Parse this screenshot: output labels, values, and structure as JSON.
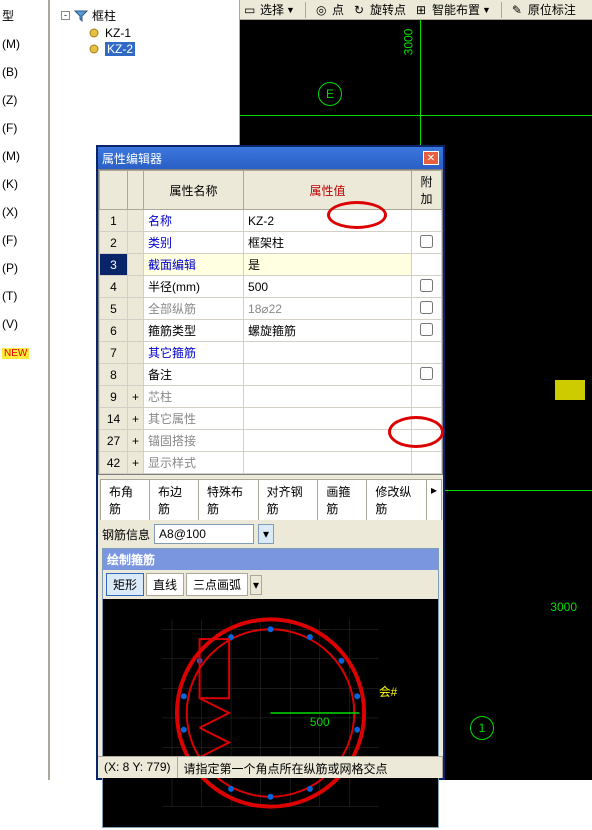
{
  "toolbar": {
    "select": "选择",
    "point": "点",
    "rotate_point": "旋转点",
    "smart_place": "智能布置",
    "origin_annot": "原位标注"
  },
  "left_items": [
    "型",
    "(M)",
    "(B)",
    "(Z)",
    "(F)",
    "(M)",
    "(K)",
    "(X)",
    "(F)",
    "(P)",
    "(T)",
    "(V)"
  ],
  "left_new": "NEW",
  "tree": {
    "root": "框柱",
    "children": [
      "KZ-1",
      "KZ-2"
    ]
  },
  "dialog_title": "属性编辑器",
  "grid": {
    "headers": {
      "name": "属性名称",
      "value": "属性值",
      "extra": "附加"
    },
    "rows": [
      {
        "n": "1",
        "name": "名称",
        "val": "KZ-2",
        "blue": true,
        "chk": false
      },
      {
        "n": "2",
        "name": "类别",
        "val": "框架柱",
        "blue": true,
        "chk": true
      },
      {
        "n": "3",
        "name": "截面编辑",
        "val": "是",
        "blue": true,
        "sel": true,
        "chk": false
      },
      {
        "n": "4",
        "name": "半径(mm)",
        "val": "500",
        "blue": false,
        "chk": true
      },
      {
        "n": "5",
        "name": "全部纵筋",
        "val": "18⌀22",
        "gray": true,
        "chk": true
      },
      {
        "n": "6",
        "name": "箍筋类型",
        "val": "螺旋箍筋",
        "blue": false,
        "chk": true
      },
      {
        "n": "7",
        "name": "其它箍筋",
        "val": "",
        "blue": true,
        "chk": false
      },
      {
        "n": "8",
        "name": "备注",
        "val": "",
        "blue": false,
        "chk": true
      },
      {
        "n": "9",
        "name": "芯柱",
        "val": "",
        "gray": true,
        "exp": "+",
        "chk": false
      },
      {
        "n": "14",
        "name": "其它属性",
        "val": "",
        "gray": true,
        "exp": "+",
        "chk": false
      },
      {
        "n": "27",
        "name": "锚固搭接",
        "val": "",
        "gray": true,
        "exp": "+",
        "chk": false
      },
      {
        "n": "42",
        "name": "显示样式",
        "val": "",
        "gray": true,
        "exp": "+",
        "chk": false
      }
    ]
  },
  "tabs": [
    "布角筋",
    "布边筋",
    "特殊布筋",
    "对齐钢筋",
    "画箍筋",
    "修改纵筋"
  ],
  "rebar_label": "钢筋信息",
  "rebar_value": "A8@100",
  "draw_header": "绘制箍筋",
  "draw_tools": [
    "矩形",
    "直线",
    "三点画弧"
  ],
  "canvas_dims": {
    "d1": "3000",
    "d2": "3000"
  },
  "bubbles": {
    "e": "E",
    "one": "1"
  },
  "status": {
    "coords": "(X: 8 Y: 779)",
    "hint": "请指定第一个角点所在纵筋或网格交点"
  },
  "section_dim": "500"
}
